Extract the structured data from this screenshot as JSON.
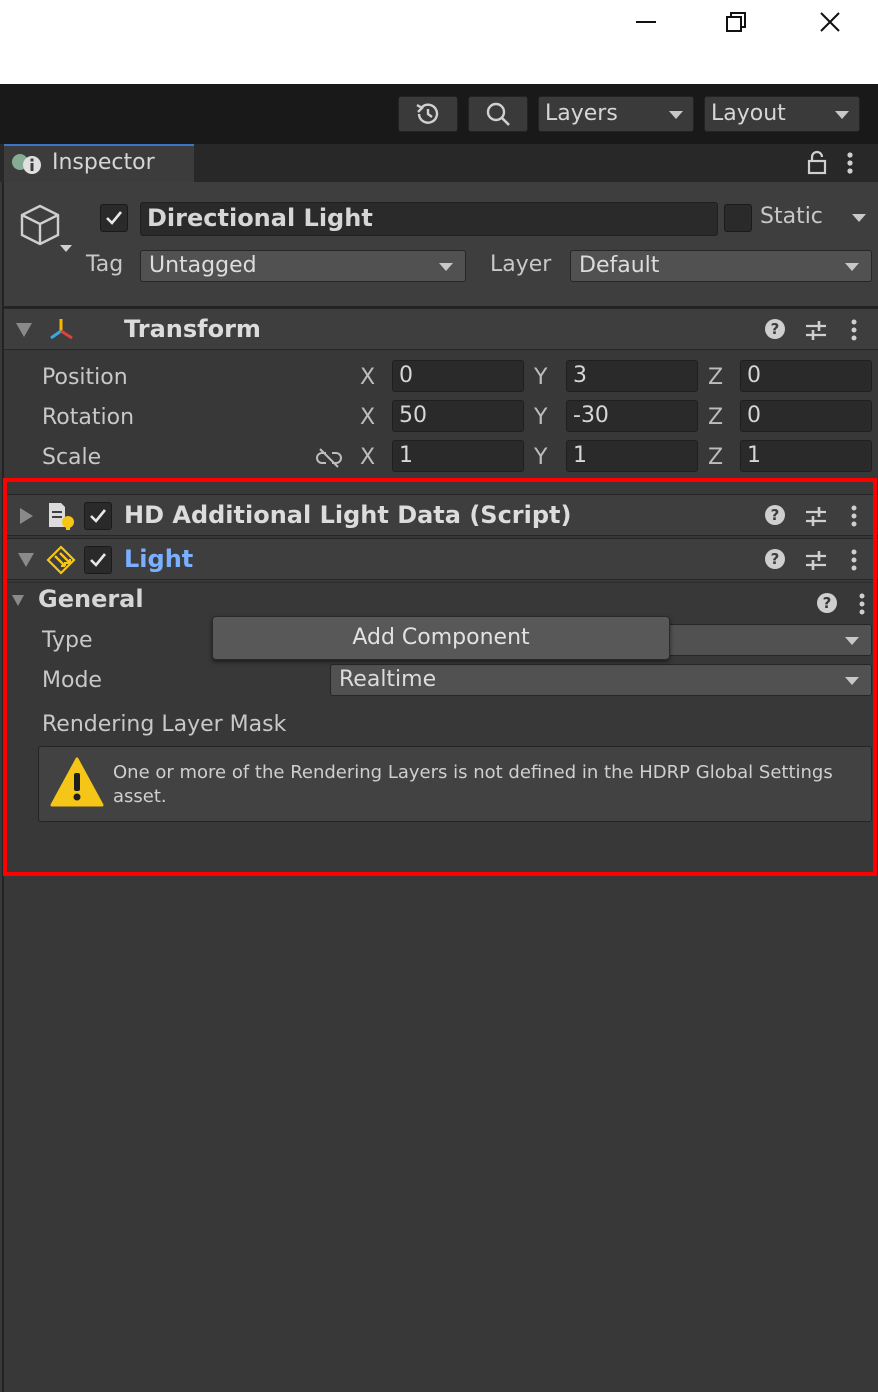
{
  "window": {
    "minimize_icon": "minimize-icon",
    "restore_icon": "restore-icon",
    "close_icon": "close-icon"
  },
  "toolbar": {
    "history_icon": "history-icon",
    "search_icon": "search-icon",
    "layers_label": "Layers",
    "layout_label": "Layout"
  },
  "tab": {
    "label": "Inspector",
    "icon": "info-icon",
    "lock_icon": "lock-icon",
    "menu_icon": "kebab-menu-icon"
  },
  "gameobject": {
    "name": "Directional Light",
    "enabled": true,
    "static_label": "Static",
    "static_checked": false,
    "tag_label": "Tag",
    "tag_value": "Untagged",
    "layer_label": "Layer",
    "layer_value": "Default"
  },
  "transform": {
    "title": "Transform",
    "rows": [
      {
        "label": "Position",
        "x": "0",
        "y": "3",
        "z": "0"
      },
      {
        "label": "Rotation",
        "x": "50",
        "y": "-30",
        "z": "0"
      },
      {
        "label": "Scale",
        "x": "1",
        "y": "1",
        "z": "1"
      }
    ],
    "axis_x": "X",
    "axis_y": "Y",
    "axis_z": "Z"
  },
  "hd_component": {
    "title": "HD Additional Light Data (Script)",
    "enabled": true
  },
  "light_component": {
    "title": "Light",
    "enabled": true,
    "title_color": "#7ab0ff"
  },
  "general": {
    "title": "General",
    "type_label": "Type",
    "mode_label": "Mode",
    "mode_value": "Realtime",
    "rendering_layer_label": "Rendering Layer Mask",
    "warning_text": "One or more of the Rendering Layers is not defined in the HDRP Global Settings asset.",
    "warning_icon": "warning-icon"
  },
  "add_component_label": "Add Component",
  "colors": {
    "highlight": "#ff0000",
    "accent": "#3a76c5",
    "warning": "#f5c518"
  }
}
